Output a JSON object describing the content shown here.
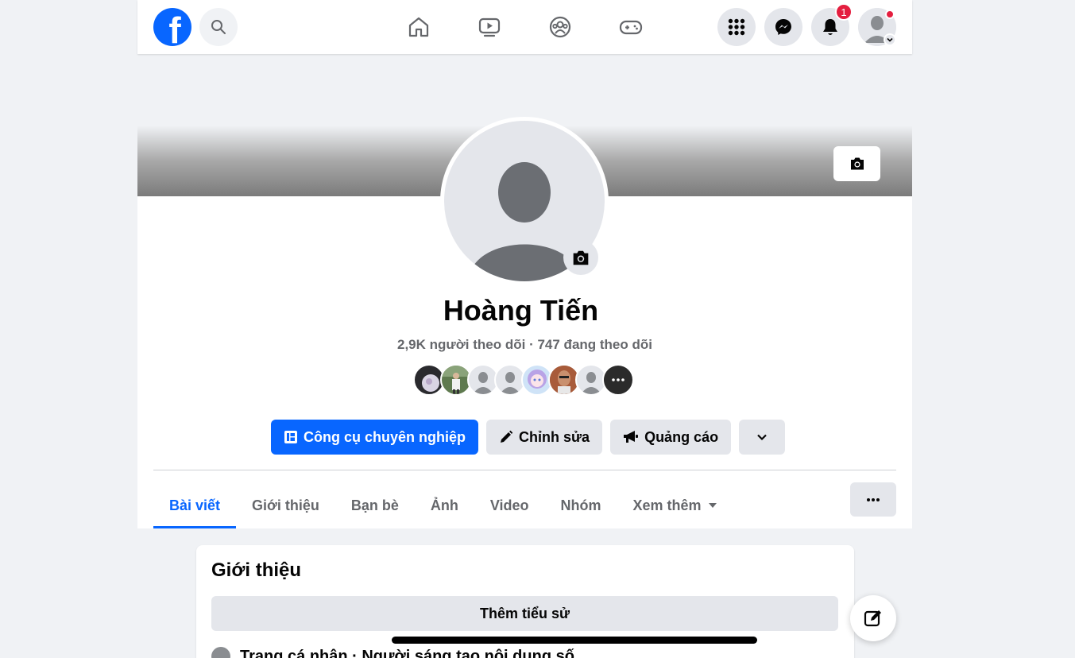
{
  "nav": {
    "logo": "f",
    "notifications_count": "1",
    "icons": [
      "search-icon",
      "home-icon",
      "watch-icon",
      "groups-icon",
      "gaming-icon",
      "menu-grid-icon",
      "messenger-icon",
      "bell-icon"
    ]
  },
  "profile": {
    "name": "Hoàng Tiến",
    "followers": "2,9K người theo dõi",
    "separator": "·",
    "following": "747 đang theo dõi",
    "friend_avatars_count": 8
  },
  "actions": {
    "professional_tools": "Công cụ chuyên nghiệp",
    "edit": "Chỉnh sửa",
    "ads": "Quảng cáo"
  },
  "tabs": [
    {
      "label": "Bài viết",
      "active": true
    },
    {
      "label": "Giới thiệu",
      "active": false
    },
    {
      "label": "Bạn bè",
      "active": false
    },
    {
      "label": "Ảnh",
      "active": false
    },
    {
      "label": "Video",
      "active": false
    },
    {
      "label": "Nhóm",
      "active": false
    },
    {
      "label": "Xem thêm",
      "active": false
    }
  ],
  "intro": {
    "title": "Giới thiệu",
    "add_bio": "Thêm tiểu sử",
    "partial_line": "Trang cá nhân · Người sáng tạo nội dung số"
  },
  "colors": {
    "brand": "#0866ff",
    "badge": "#e41e3f",
    "background": "#f0f2f5"
  }
}
